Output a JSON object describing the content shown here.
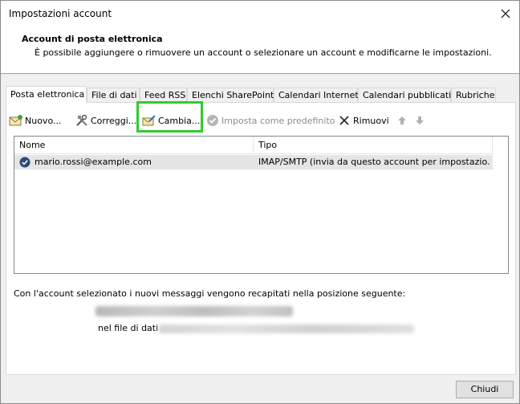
{
  "window": {
    "title": "Impostazioni account",
    "close_icon": "close-icon"
  },
  "header": {
    "title": "Account di posta elettronica",
    "description": "È possibile aggiungere o rimuovere un account o selezionare un account e modificarne le impostazioni."
  },
  "tabs": [
    {
      "label": "Posta elettronica",
      "active": true
    },
    {
      "label": "File di dati",
      "active": false
    },
    {
      "label": "Feed RSS",
      "active": false
    },
    {
      "label": "Elenchi SharePoint",
      "active": false
    },
    {
      "label": "Calendari Internet",
      "active": false
    },
    {
      "label": "Calendari pubblicati",
      "active": false
    },
    {
      "label": "Rubriche",
      "active": false
    }
  ],
  "toolbar": {
    "new_label": "Nuovo...",
    "repair_label": "Correggi...",
    "change_label": "Cambia...",
    "set_default_label": "Imposta come predefinito",
    "remove_label": "Rimuovi"
  },
  "accounts_table": {
    "columns": [
      "Nome",
      "Tipo"
    ],
    "rows": [
      {
        "name": "mario.rossi@example.com",
        "type": "IMAP/SMTP (invia da questo account per impostazio..."
      }
    ]
  },
  "delivery": {
    "text": "Con l'account selezionato i nuovi messaggi vengono recapitati nella posizione seguente:",
    "datafile_label": "nel file di dati"
  },
  "footer": {
    "close_label": "Chiudi"
  },
  "colors": {
    "highlight": "#2ecc2e",
    "selected_row": "#e5e5e5"
  }
}
